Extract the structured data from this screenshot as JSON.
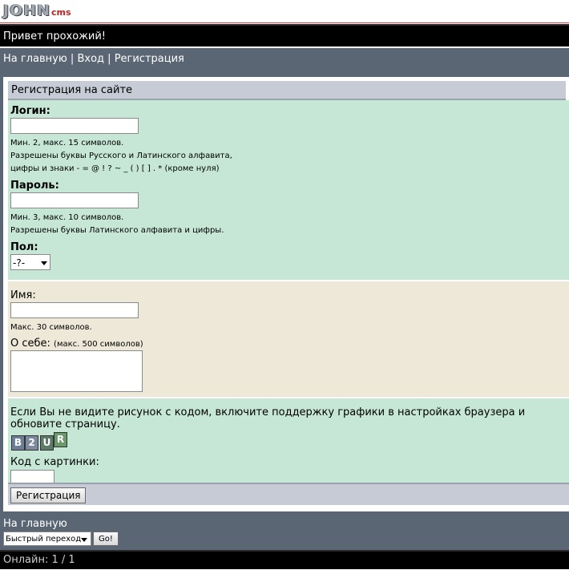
{
  "logo": {
    "main": "JOHN",
    "sub": "cms"
  },
  "greeting": "Привет прохожий!",
  "top_nav": {
    "home": "На главную",
    "login": "Вход",
    "register": "Регистрация",
    "separator": "|"
  },
  "panel": {
    "title": "Регистрация на сайте"
  },
  "form": {
    "login_label": "Логин:",
    "login_value": "",
    "login_hint1": "Мин. 2, макс. 15 символов.",
    "login_hint2": "Разрешены буквы Русского и Латинского алфавита,",
    "login_hint3": "цифры и знаки - = @ ! ? ~ _ ( ) [ ] . * (кроме нуля)",
    "password_label": "Пароль:",
    "password_value": "",
    "password_hint1": "Мин. 3, макс. 10 символов.",
    "password_hint2": "Разрешены буквы Латинского алфавита и цифры.",
    "gender_label": "Пол:",
    "gender_value": "-?-",
    "name_label": "Имя:",
    "name_value": "",
    "name_hint": "Макс. 30 символов.",
    "about_label": "О себе:",
    "about_hint": "(макс. 500 символов)",
    "captcha_notice": "Если Вы не видите рисунок с кодом, включите поддержку графики в настройках браузера и обновите страницу.",
    "captcha_chars": [
      "B",
      "2",
      "U",
      "R"
    ],
    "captcha_colors": [
      "#6b7f99",
      "#7d8aa0",
      "#5d7a6a",
      "#6a9a6a"
    ],
    "code_label": "Код с картинки:",
    "code_value": "",
    "submit_label": "Регистрация"
  },
  "footer": {
    "home": "На главную",
    "quick_nav": "Быстрый переход",
    "go_label": "Go!",
    "online": "Онлайн: 1 / 1"
  },
  "colors": {
    "nav_bg": "#5a6674",
    "green_section": "#c6e6d6",
    "beige_section": "#ede8d8",
    "header_section": "#c6cbd6",
    "accent_red": "#c02020"
  }
}
